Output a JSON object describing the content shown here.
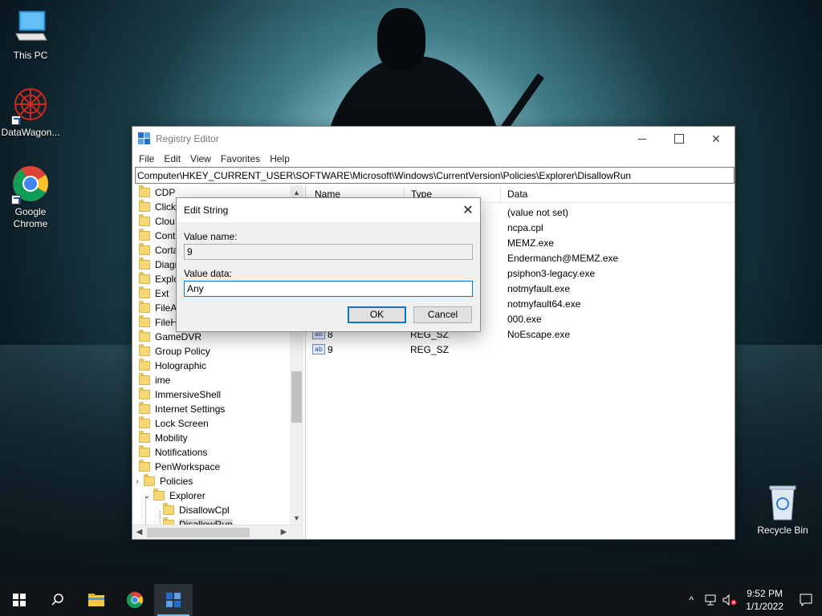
{
  "desktop": {
    "icons": [
      {
        "label": "This PC"
      },
      {
        "label": "DataWagon..."
      },
      {
        "label": "Google\nChrome"
      },
      {
        "label": "Recycle Bin"
      }
    ]
  },
  "regedit": {
    "title": "Registry Editor",
    "menu": [
      "File",
      "Edit",
      "View",
      "Favorites",
      "Help"
    ],
    "address": "Computer\\HKEY_CURRENT_USER\\SOFTWARE\\Microsoft\\Windows\\CurrentVersion\\Policies\\Explorer\\DisallowRun",
    "tree": [
      "CDP",
      "Click",
      "Clou",
      "Cont",
      "Corta",
      "Diagn",
      "Explo",
      "Ext",
      "FileA",
      "FileH",
      "GameDVR",
      "Group Policy",
      "Holographic",
      "ime",
      "ImmersiveShell",
      "Internet Settings",
      "Lock Screen",
      "Mobility",
      "Notifications",
      "PenWorkspace",
      "Policies",
      "Explorer",
      "DisallowCpl",
      "DisallowRun"
    ],
    "columns": {
      "name": "Name",
      "type": "Type",
      "data": "Data"
    },
    "values_data": [
      "(value not set)",
      "ncpa.cpl",
      "MEMZ.exe",
      "Endermanch@MEMZ.exe",
      "psiphon3-legacy.exe",
      "notmyfault.exe",
      "notmyfault64.exe",
      "000.exe",
      "NoEscape.exe"
    ],
    "visible_rows": [
      {
        "name": "8",
        "type": "REG_SZ",
        "data": "NoEscape.exe"
      },
      {
        "name": "9",
        "type": "REG_SZ",
        "data": ""
      }
    ]
  },
  "dialog": {
    "title": "Edit String",
    "value_name_label": "Value name:",
    "value_name": "9",
    "value_data_label": "Value data:",
    "value_data": "Any",
    "ok_label": "OK",
    "cancel_label": "Cancel",
    "close_glyph": "✕"
  },
  "taskbar": {
    "time": "9:52 PM",
    "date": "1/1/2022"
  }
}
